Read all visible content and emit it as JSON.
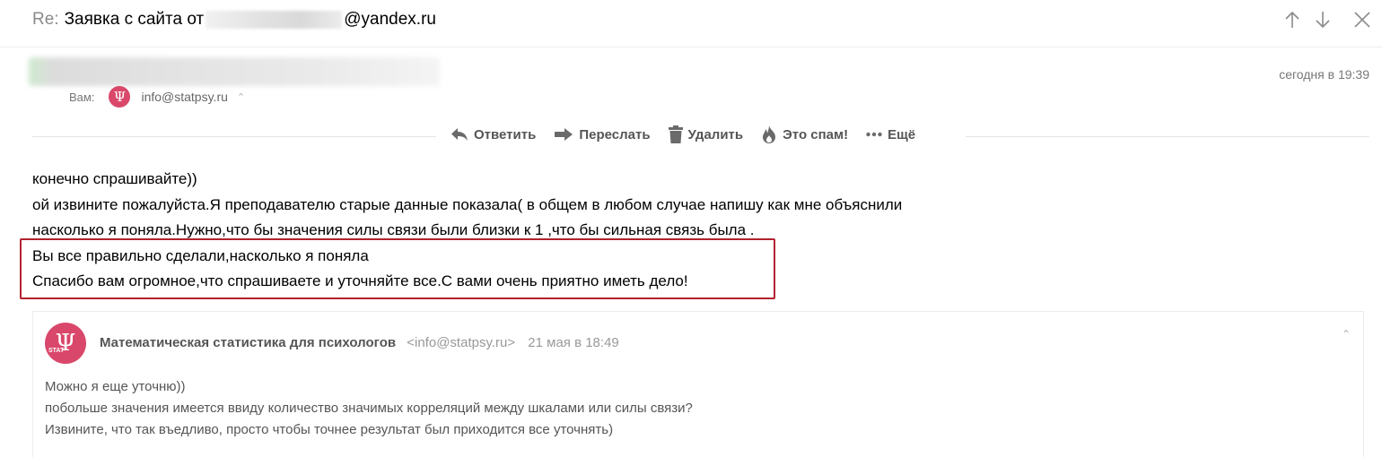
{
  "subject": {
    "prefix": "Re:",
    "text_before": "Заявка с сайта от",
    "text_after": "@yandex.ru"
  },
  "message": {
    "date": "сегодня в 19:39",
    "to_label": "Вам:",
    "to_email": "info@statpsy.ru",
    "avatar_symbol": "Ψ"
  },
  "toolbar": {
    "reply_label": "Ответить",
    "forward_label": "Переслать",
    "delete_label": "Удалить",
    "spam_label": "Это спам!",
    "more_label": "Ещё"
  },
  "body": {
    "lines": [
      "конечно спрашивайте))",
      "ой извините пожалуйста.Я преподавателю старые данные показала( в общем в любом случае напишу как мне объяснили",
      "насколько я поняла.Нужно,что бы значения силы связи были близки к 1 ,что бы сильная связь была .",
      "Вы все правильно сделали,насколько я поняла",
      "Спасибо вам огромное,что спрашиваете и уточняйте все.С вами очень приятно иметь дело!"
    ]
  },
  "quoted": {
    "avatar_symbol": "Ψ",
    "avatar_text": "STAT",
    "sender_name": "Математическая статистика для психологов",
    "sender_email": "<info@statpsy.ru>",
    "date": "21 мая в 18:49",
    "lines": [
      "Можно я еще уточню))",
      "побольше значения имеется ввиду количество значимых корреляций между шкалами или силы связи?",
      "Извините, что так въедливо, просто чтобы точнее результат был приходится все уточнять)"
    ]
  },
  "colors": {
    "accent_red": "#b1232e",
    "avatar_pink": "#d9476a"
  }
}
